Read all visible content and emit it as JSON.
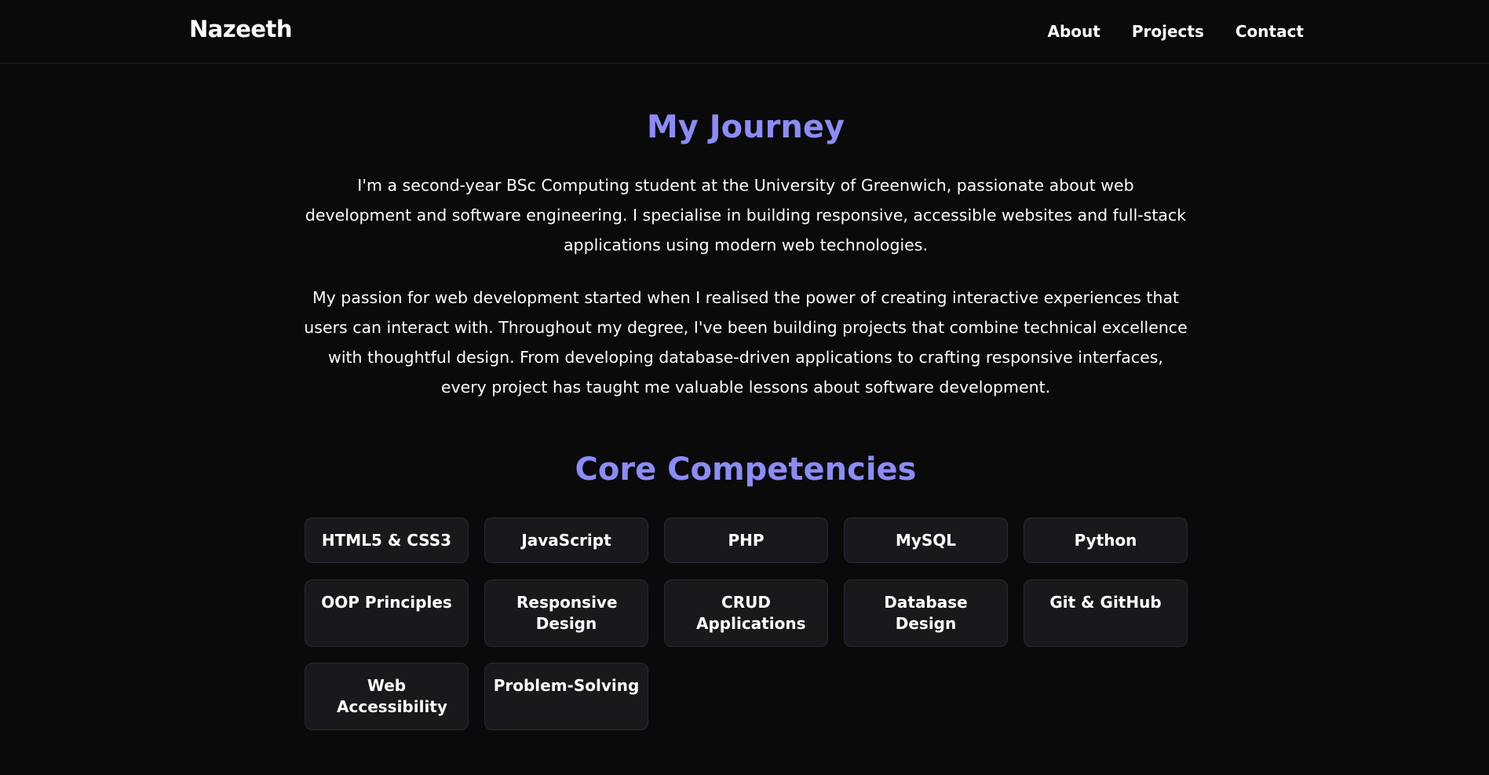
{
  "nav": {
    "logo": "Nazeeth",
    "links": [
      "About",
      "Projects",
      "Contact"
    ]
  },
  "journey": {
    "title": "My Journey",
    "paragraphs": [
      "I'm a second-year BSc Computing student at the University of Greenwich, passionate about web development and software engineering. I specialise in building responsive, accessible websites and full-stack applications using modern web technologies.",
      "My passion for web development started when I realised the power of creating interactive experiences that users can interact with. Throughout my degree, I've been building projects that combine technical excellence with thoughtful design. From developing database-driven applications to crafting responsive interfaces, every project has taught me valuable lessons about software development."
    ]
  },
  "competencies": {
    "title": "Core Competencies",
    "items": [
      "HTML5 & CSS3",
      "JavaScript",
      "PHP",
      "MySQL",
      "Python",
      "OOP Principles",
      "Responsive Design",
      "CRUD Applications",
      "Database Design",
      "Git & GitHub",
      "Web Accessibility",
      "Problem-Solving"
    ]
  },
  "colors": {
    "background": "#0a0a0a",
    "accent": "#8b8cf6",
    "card_background": "#18191d",
    "card_border": "#262a3a"
  }
}
